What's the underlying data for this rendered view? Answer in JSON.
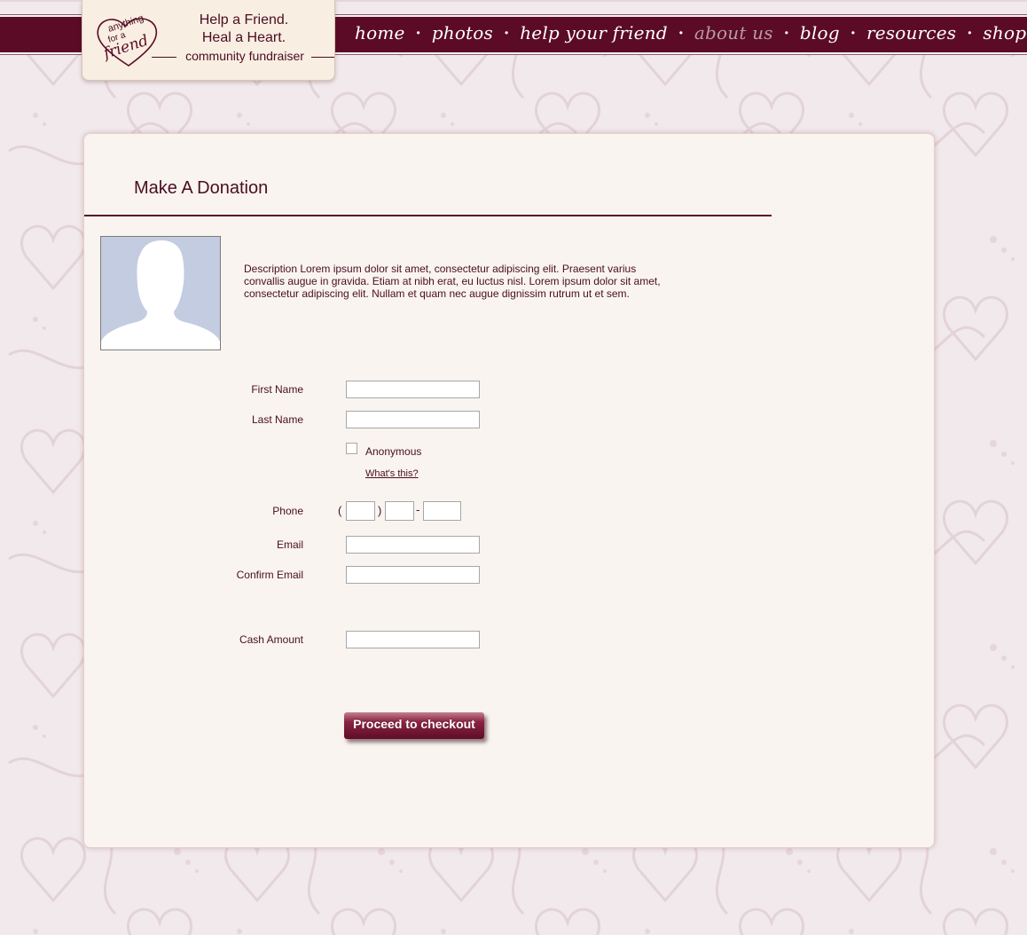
{
  "logo": {
    "mark_words": [
      "anything",
      "for a",
      "friend"
    ],
    "line1": "Help a Friend.",
    "line2": "Heal a Heart.",
    "line3": "community fundraiser"
  },
  "nav": {
    "items": [
      {
        "label": "home",
        "active": false
      },
      {
        "label": "photos",
        "active": false
      },
      {
        "label": "help your friend",
        "active": false
      },
      {
        "label": "about us",
        "active": true
      },
      {
        "label": "blog",
        "active": false
      },
      {
        "label": "resources",
        "active": false
      },
      {
        "label": "shop",
        "active": false
      }
    ],
    "separator": "•"
  },
  "page": {
    "title": "Make A Donation",
    "description": "Description Lorem ipsum dolor sit amet, consectetur adipiscing elit. Praesent varius convallis augue in gravida. Etiam at nibh erat, eu luctus nisl. Lorem ipsum dolor sit amet, consectetur adipiscing elit. Nullam et quam nec augue dignissim rutrum ut et sem."
  },
  "form": {
    "first_name_label": "First Name",
    "first_name_value": "",
    "last_name_label": "Last Name",
    "last_name_value": "",
    "anonymous_label": "Anonymous",
    "anonymous_checked": false,
    "whats_this_link": "What's this?",
    "phone_label": "Phone",
    "phone_open_paren": "(",
    "phone_close_paren": ")",
    "phone_dash": "-",
    "phone_area": "",
    "phone_prefix": "",
    "phone_line": "",
    "email_label": "Email",
    "email_value": "",
    "confirm_email_label": "Confirm Email",
    "confirm_email_value": "",
    "cash_amount_label": "Cash Amount",
    "cash_amount_value": "",
    "checkout_button": "Proceed to checkout"
  },
  "colors": {
    "brand_maroon": "#5b0b26",
    "text": "#4a0d22",
    "panel_bg": "#f9f4ef",
    "page_bg": "#f1e9ec",
    "active_nav": "#b89aa5"
  }
}
